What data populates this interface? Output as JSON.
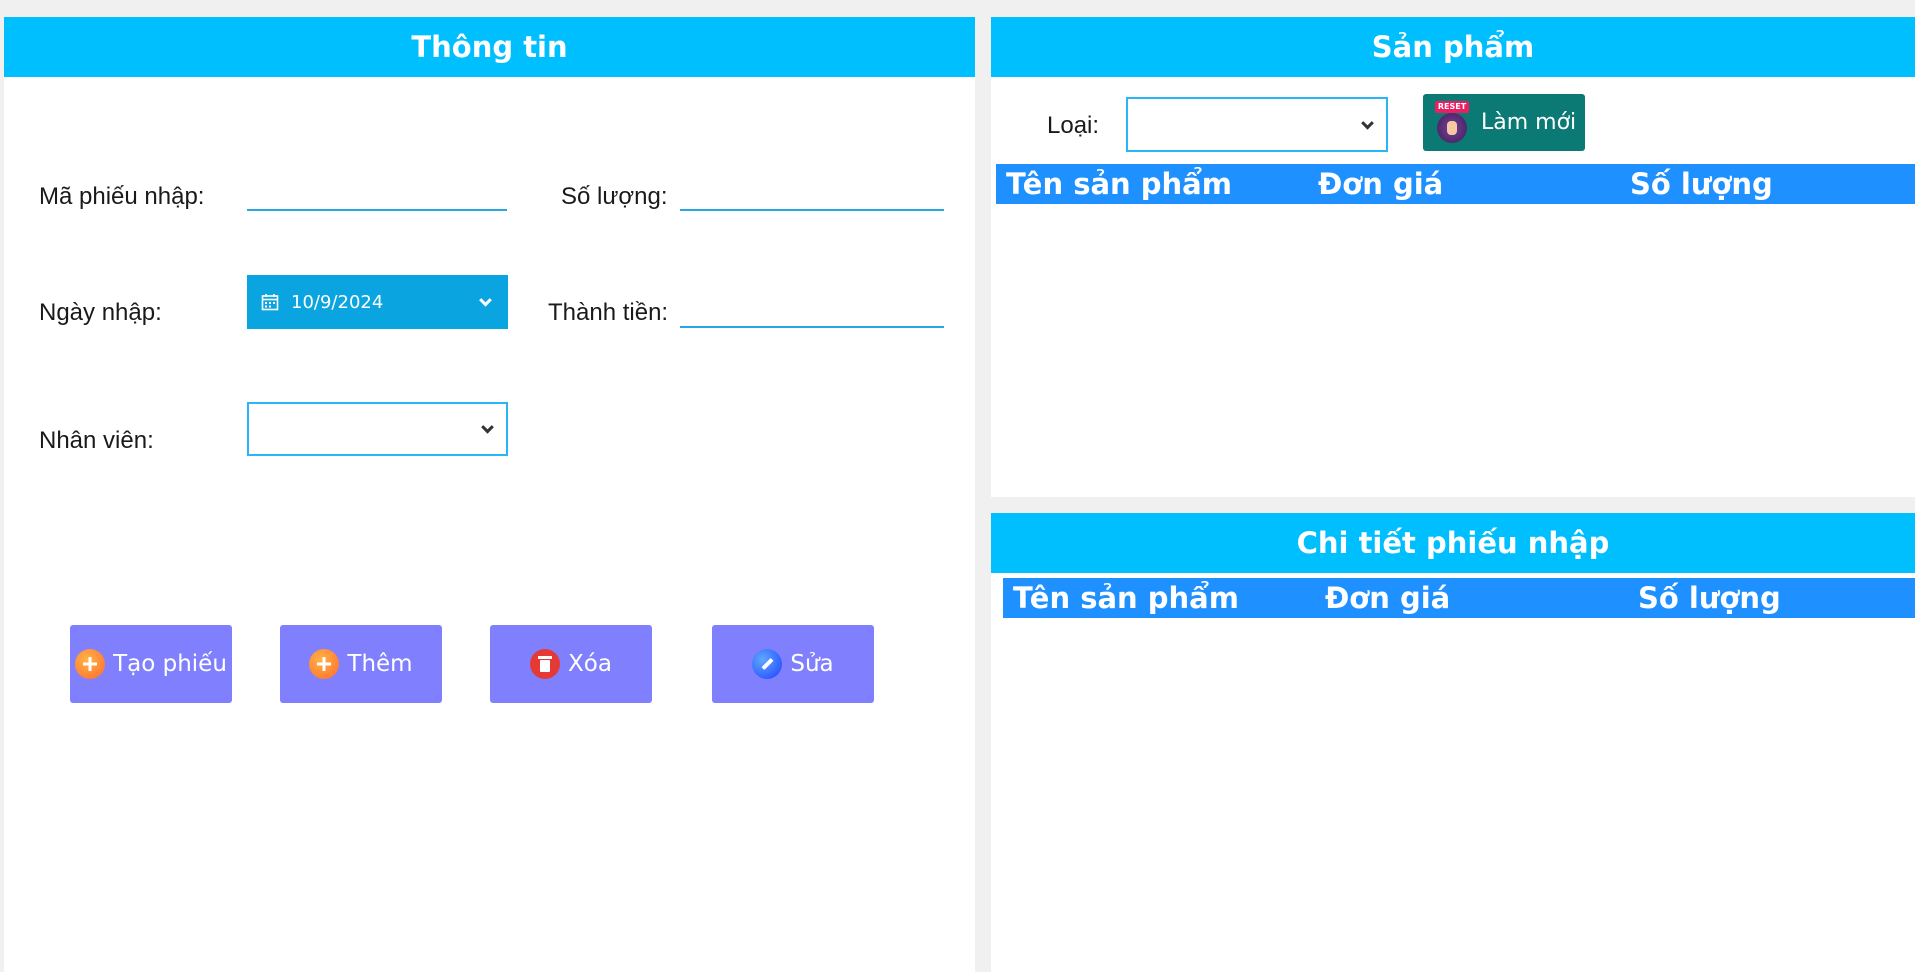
{
  "info_panel": {
    "title": "Thông tin",
    "ma_phieu_label": "Mã phiếu nhập:",
    "ma_phieu_value": "",
    "so_luong_label": "Số lượng:",
    "so_luong_value": "",
    "ngay_nhap_label": "Ngày nhập:",
    "ngay_nhap_value": "10/9/2024",
    "thanh_tien_label": "Thành tiền:",
    "thanh_tien_value": "",
    "nhan_vien_label": "Nhân viên:",
    "nhan_vien_value": "",
    "buttons": {
      "tao_phieu": "Tạo phiếu",
      "them": "Thêm",
      "xoa": "Xóa",
      "sua": "Sửa"
    }
  },
  "product_panel": {
    "title": "Sản phẩm",
    "loai_label": "Loại:",
    "loai_value": "",
    "reset_label": "Làm mới",
    "reset_icon_text": "RESET",
    "columns": [
      "Tên sản phẩm",
      "Đơn giá",
      "Số lượng"
    ],
    "rows": []
  },
  "detail_panel": {
    "title": "Chi tiết phiếu nhập",
    "columns": [
      "Tên sản phẩm",
      "Đơn giá",
      "Số lượng"
    ],
    "rows": []
  },
  "colors": {
    "header_bg": "#00bfff",
    "table_header_bg": "#1e90ff",
    "action_button_bg": "#8080ff",
    "reset_button_bg": "#0b7a75",
    "date_picker_bg": "#0aa5e0"
  }
}
